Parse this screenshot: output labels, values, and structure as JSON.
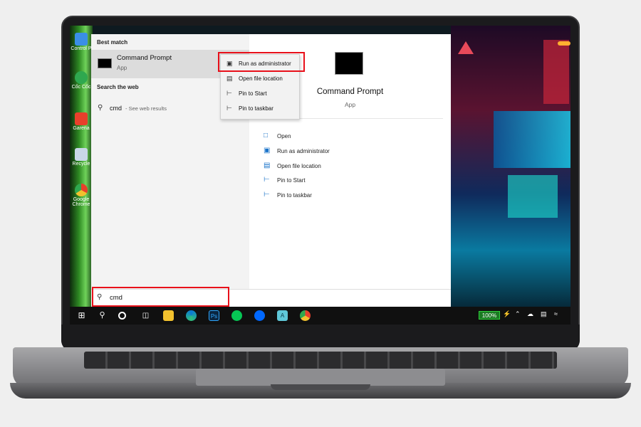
{
  "desktop_icons": [
    {
      "label": "Control P",
      "icon": "control-panel-icon",
      "color": "#3a8ee6"
    },
    {
      "label": "Cốc Cốc",
      "icon": "coccoc-icon",
      "color": "#2fa84f"
    },
    {
      "label": "Garena",
      "icon": "garena-icon",
      "color": "#e8402b"
    },
    {
      "label": "Recycle",
      "icon": "recycle-bin-icon",
      "color": "#c9d7e8"
    },
    {
      "label": "Google Chrome",
      "icon": "chrome-icon",
      "color": "#f2c12e"
    }
  ],
  "start_menu": {
    "best_match_label": "Best match",
    "best_match": {
      "title": "Command Prompt",
      "subtitle": "App"
    },
    "search_web_label": "Search the web",
    "web_result": {
      "query": "cmd",
      "suffix": "- See web results"
    },
    "context_menu": [
      {
        "icon": "admin-run-icon",
        "label": "Run as administrator"
      },
      {
        "icon": "folder-location-icon",
        "label": "Open file location"
      },
      {
        "icon": "pin-icon",
        "label": "Pin to Start"
      },
      {
        "icon": "pin-taskbar-icon",
        "label": "Pin to taskbar"
      }
    ],
    "detail": {
      "title": "Command Prompt",
      "subtitle": "App",
      "actions": [
        {
          "icon": "open-icon",
          "label": "Open"
        },
        {
          "icon": "admin-run-icon",
          "label": "Run as administrator"
        },
        {
          "icon": "folder-location-icon",
          "label": "Open file location"
        },
        {
          "icon": "pin-icon",
          "label": "Pin to Start"
        },
        {
          "icon": "pin-taskbar-icon",
          "label": "Pin to taskbar"
        }
      ]
    }
  },
  "search_box": {
    "value": "cmd"
  },
  "taskbar": {
    "battery": "100%",
    "apps": [
      "windows-start-icon",
      "search-icon",
      "cortana-icon",
      "task-view-icon",
      "file-explorer-icon",
      "edge-icon",
      "photoshop-icon",
      "line-icon",
      "zalo-icon",
      "notepad-icon",
      "chrome-icon"
    ]
  },
  "colors": {
    "highlight": "#e8101a",
    "accent": "#1a73c9"
  }
}
